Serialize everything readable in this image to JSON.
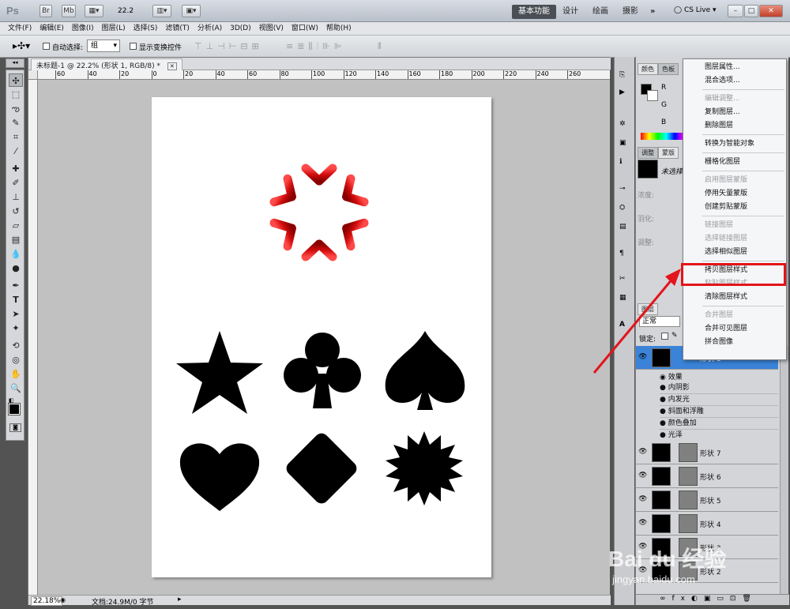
{
  "app": {
    "logo": "Ps",
    "zoom_select": "22.2",
    "workspaces": [
      "基本功能",
      "设计",
      "绘画",
      "摄影"
    ],
    "more": "»",
    "cs_live": "CS Live",
    "window_controls": [
      "–",
      "□",
      "✕"
    ],
    "title_buttons": [
      "Br",
      "Mb"
    ]
  },
  "menubar": [
    "文件(F)",
    "编辑(E)",
    "图像(I)",
    "图层(L)",
    "选择(S)",
    "滤镜(T)",
    "分析(A)",
    "3D(D)",
    "视图(V)",
    "窗口(W)",
    "帮助(H)"
  ],
  "options": {
    "auto_select_label": "自动选择:",
    "auto_select_value": "组",
    "show_transform_label": "显示变换控件"
  },
  "document": {
    "tab_title": "未标题-1 @ 22.2% (形状 1, RGB/8) *",
    "tab_close": "✕",
    "ruler_marks": [
      "60",
      "40",
      "20",
      "0",
      "20",
      "40",
      "60",
      "80",
      "100",
      "120",
      "140",
      "160",
      "180",
      "200",
      "220",
      "240",
      "260"
    ],
    "zoom": "22.18%",
    "doc_info": "文档:24.9M/0 字节"
  },
  "panels": {
    "color_tab": "颜色",
    "swatches_tab": "色板",
    "adjust_tab": "调整",
    "masks_tab": "蒙版",
    "layers_tab": "图层",
    "channel_r": "R",
    "channel_g": "G",
    "channel_b": "B",
    "mask_hint": "未选择",
    "density": "浓度:",
    "feather": "羽化:",
    "refine": "调整:",
    "blend_mode": "正常",
    "lock_label": "锁定:",
    "effects_label": "效果",
    "effects": [
      "内阴影",
      "内发光",
      "斜面和浮雕",
      "颜色叠加",
      "光泽"
    ],
    "layers": [
      {
        "name": "形状 1",
        "selected": true
      },
      {
        "name": "形状 7",
        "selected": false
      },
      {
        "name": "形状 6",
        "selected": false
      },
      {
        "name": "形状 5",
        "selected": false
      },
      {
        "name": "形状 4",
        "selected": false
      },
      {
        "name": "形状 3",
        "selected": false
      },
      {
        "name": "形状 2",
        "selected": false
      }
    ]
  },
  "context_menu": [
    {
      "label": "图层属性...",
      "enabled": true
    },
    {
      "label": "混合选项...",
      "enabled": true
    },
    {
      "label": "编辑调整...",
      "enabled": false
    },
    {
      "label": "复制图层...",
      "enabled": true
    },
    {
      "label": "删除图层",
      "enabled": true
    },
    {
      "label": "转换为智能对象",
      "enabled": true
    },
    {
      "label": "栅格化图层",
      "enabled": true
    },
    {
      "label": "启用图层蒙版",
      "enabled": false
    },
    {
      "label": "停用矢量蒙版",
      "enabled": true
    },
    {
      "label": "创建剪贴蒙版",
      "enabled": true
    },
    {
      "label": "链接图层",
      "enabled": false
    },
    {
      "label": "选择链接图层",
      "enabled": false
    },
    {
      "label": "选择相似图层",
      "enabled": true
    },
    {
      "label": "拷贝图层样式",
      "enabled": true
    },
    {
      "label": "粘贴图层样式",
      "enabled": false
    },
    {
      "label": "清除图层样式",
      "enabled": true
    },
    {
      "label": "合并图层",
      "enabled": false
    },
    {
      "label": "合并可见图层",
      "enabled": true
    },
    {
      "label": "拼合图像",
      "enabled": true
    }
  ],
  "watermark": {
    "brand": "Bai du 经验",
    "url": "jingyan.baidu.com"
  },
  "colors": {
    "highlight": "#e3141b",
    "snowflake": "#e01010",
    "selected_layer": "#3a83d8"
  }
}
